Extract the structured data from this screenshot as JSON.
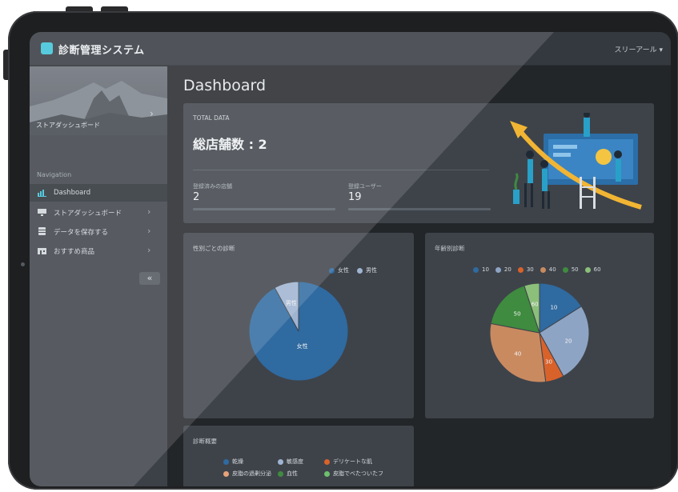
{
  "app": {
    "title": "診断管理システム",
    "user_menu": "スリーアール ▾",
    "brand_color": "#3cc3d8"
  },
  "sidebar": {
    "profile_name": "ストアダッシュボード",
    "section_label": "Navigation",
    "items": [
      {
        "label": "Dashboard",
        "icon": "chart-icon",
        "active": true
      },
      {
        "label": "ストアダッシュボード",
        "icon": "store-icon",
        "active": false
      },
      {
        "label": "データを保存する",
        "icon": "database-icon",
        "active": false
      },
      {
        "label": "おすすめ商品",
        "icon": "shop-icon",
        "active": false
      }
    ],
    "collapse_label": "«"
  },
  "page": {
    "title": "Dashboard"
  },
  "total_card": {
    "label": "TOTAL DATA",
    "headline": "総店舗数 : 2",
    "stats": [
      {
        "label": "登録済みの店舗",
        "value": "2"
      },
      {
        "label": "登録ユーザー",
        "value": "19"
      }
    ]
  },
  "gender_card": {
    "title": "性別ごとの診断",
    "legend": [
      {
        "label": "女性",
        "color": "#2f6aa0"
      },
      {
        "label": "男性",
        "color": "#9fb4d1"
      }
    ]
  },
  "age_card": {
    "title": "年齢別診断",
    "legend": [
      {
        "label": "10",
        "color": "#2f6aa0"
      },
      {
        "label": "20",
        "color": "#8ea4c4"
      },
      {
        "label": "30",
        "color": "#d9622b"
      },
      {
        "label": "40",
        "color": "#c98a60"
      },
      {
        "label": "50",
        "color": "#3f8b3f"
      },
      {
        "label": "60",
        "color": "#8cbf7a"
      }
    ]
  },
  "summary_card": {
    "title": "診断概要",
    "legend": [
      {
        "label": "乾燥",
        "color": "#2f6aa0"
      },
      {
        "label": "敏感度",
        "color": "#9fb4d1"
      },
      {
        "label": "デリケートな肌",
        "color": "#d9622b"
      },
      {
        "label": "皮脂の過剰分泌",
        "color": "#e6a27a"
      },
      {
        "label": "血性",
        "color": "#3f8b3f"
      },
      {
        "label": "皮脂でべたついたフ",
        "color": "#6fbf6f"
      }
    ]
  },
  "chart_data": [
    {
      "type": "pie",
      "title": "性別ごとの診断",
      "categories": [
        "女性",
        "男性"
      ],
      "values": [
        92,
        8
      ],
      "colors": [
        "#2f6aa0",
        "#9fb4d1"
      ]
    },
    {
      "type": "pie",
      "title": "年齢別診断",
      "categories": [
        "10",
        "20",
        "30",
        "40",
        "50",
        "60"
      ],
      "values": [
        16,
        26,
        6,
        30,
        17,
        5
      ],
      "colors": [
        "#2f6aa0",
        "#8ea4c4",
        "#d9622b",
        "#c98a60",
        "#3f8b3f",
        "#8cbf7a"
      ]
    }
  ]
}
